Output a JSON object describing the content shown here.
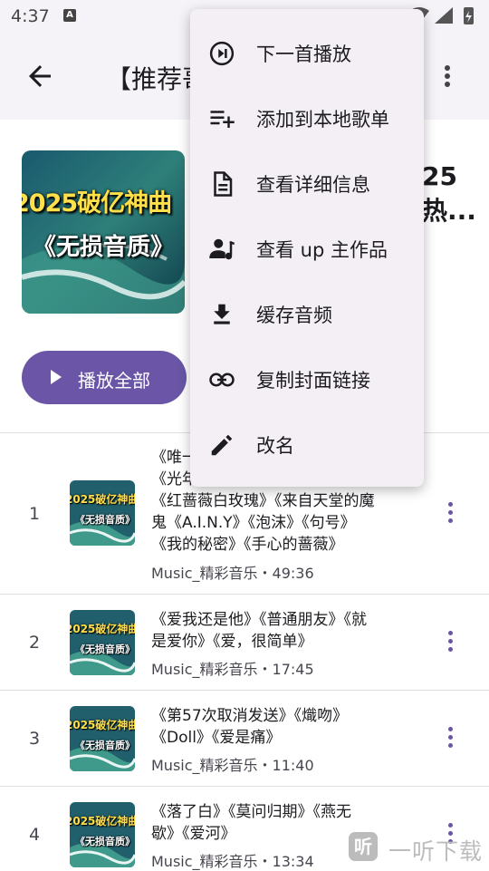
{
  "status_bar": {
    "time": "4:37",
    "notif_letter": "A"
  },
  "app_bar": {
    "title": "【推荐哥"
  },
  "header": {
    "cover_line1": "2025破亿神曲",
    "cover_line2": "《无损音质》",
    "playlist_title_fragment_1": "25",
    "playlist_title_fragment_2": "热...",
    "play_all_label": "播放全部"
  },
  "menu": {
    "items": [
      {
        "icon": "play-next-icon",
        "label": "下一首播放"
      },
      {
        "icon": "playlist-add-icon",
        "label": "添加到本地歌单"
      },
      {
        "icon": "document-icon",
        "label": "查看详细信息"
      },
      {
        "icon": "person-music-icon",
        "label": "查看 up 主作品"
      },
      {
        "icon": "download-icon",
        "label": "缓存音频"
      },
      {
        "icon": "link-icon",
        "label": "复制封面链接"
      },
      {
        "icon": "pencil-icon",
        "label": "改名"
      }
    ]
  },
  "songs": [
    {
      "index": "1",
      "title_lines": [
        "《唯一",
        "《光年之外》《当可》《新娘",
        "《红蔷薇白玫瑰》《来自天堂的魔",
        "鬼《A.I.N.Y》《泡沫》《句号》",
        "《我的秘密》《手心的蔷薇》"
      ],
      "subtitle": "Music_精彩音乐・49:36",
      "thumb_line1": "2025破亿神曲",
      "thumb_line2": "《无损音质》"
    },
    {
      "index": "2",
      "title_lines": [
        "《爱我还是他》《普通朋友》《就",
        "是爱你》《爱，很简单》"
      ],
      "subtitle": "Music_精彩音乐・17:45",
      "thumb_line1": "2025破亿神曲",
      "thumb_line2": "《无损音质》"
    },
    {
      "index": "3",
      "title_lines": [
        "《第57次取消发送》《熾吻》",
        "《Doll》《爱是痛》"
      ],
      "subtitle": "Music_精彩音乐・11:40",
      "thumb_line1": "2025破亿神曲",
      "thumb_line2": "《无损音质》"
    },
    {
      "index": "4",
      "title_lines": [
        "《落了白》《莫问归期》《燕无",
        "歇》《爱河》"
      ],
      "subtitle": "Music_精彩音乐・13:34",
      "thumb_line1": "2025破亿神曲",
      "thumb_line2": "《无损音质》"
    }
  ],
  "watermark": {
    "icon_char": "听",
    "text": "一听下载"
  },
  "colors": {
    "accent": "#6a55a6",
    "appbar_bg": "#f5f3f7",
    "menu_bg": "#f3eff4"
  }
}
